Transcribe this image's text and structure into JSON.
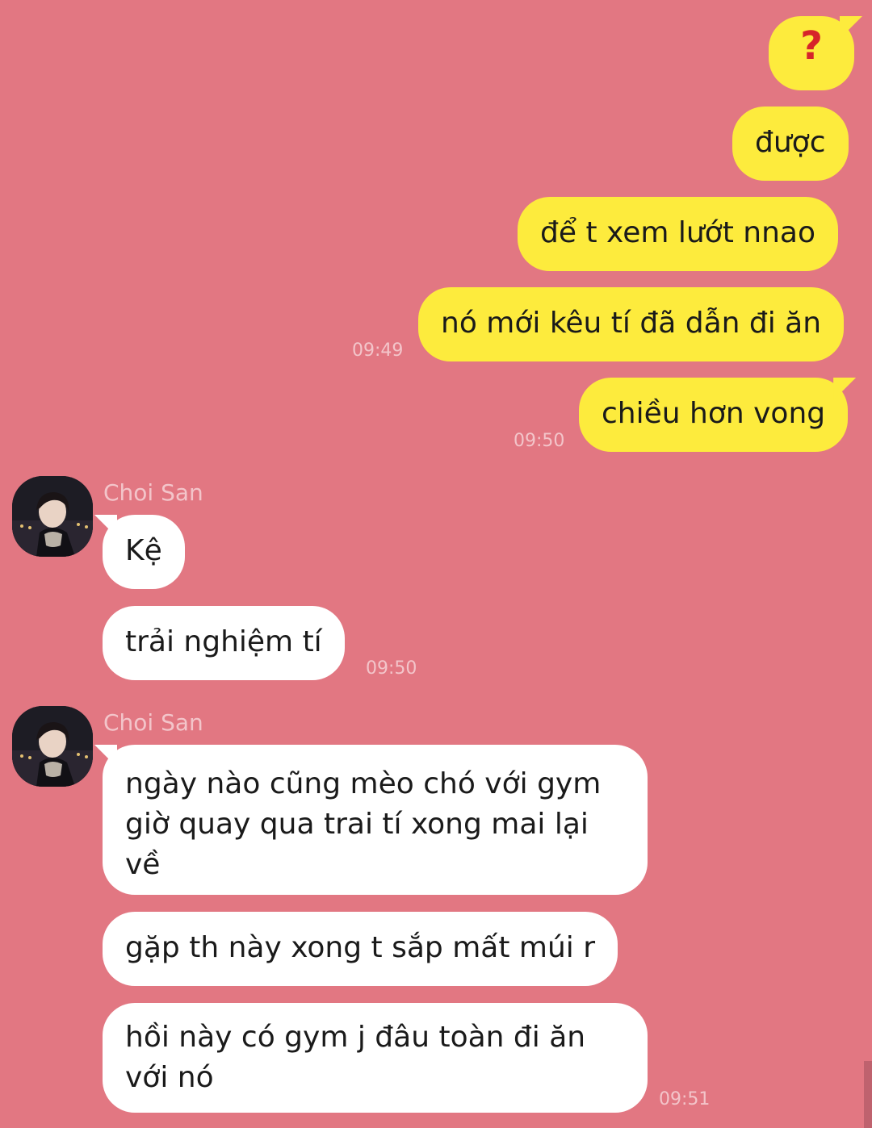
{
  "outgoing": [
    {
      "text": "?"
    },
    {
      "text": "được"
    },
    {
      "text": "để t xem lướt nnao"
    },
    {
      "text": "nó mới kêu tí đã dẫn đi ăn",
      "time": "09:49"
    },
    {
      "text": "chiều hơn vong",
      "time": "09:50"
    }
  ],
  "groups": [
    {
      "sender": "Choi San",
      "messages": [
        {
          "text": "Kệ"
        },
        {
          "text": "trải nghiệm tí",
          "time": "09:50"
        }
      ]
    },
    {
      "sender": "Choi San",
      "messages": [
        {
          "text": "ngày nào cũng mèo chó với gym giờ quay qua trai tí xong mai lại về"
        },
        {
          "text": "gặp th này xong t sắp mất múi r"
        },
        {
          "text": "hồi này có gym j đâu toàn đi ăn với nó",
          "time": "09:51"
        }
      ]
    }
  ],
  "colors": {
    "background": "#e27782",
    "outgoing_bubble": "#fdeb3d",
    "incoming_bubble": "#ffffff",
    "timestamp": "#f3c5ca",
    "question_mark": "#d6242a"
  }
}
